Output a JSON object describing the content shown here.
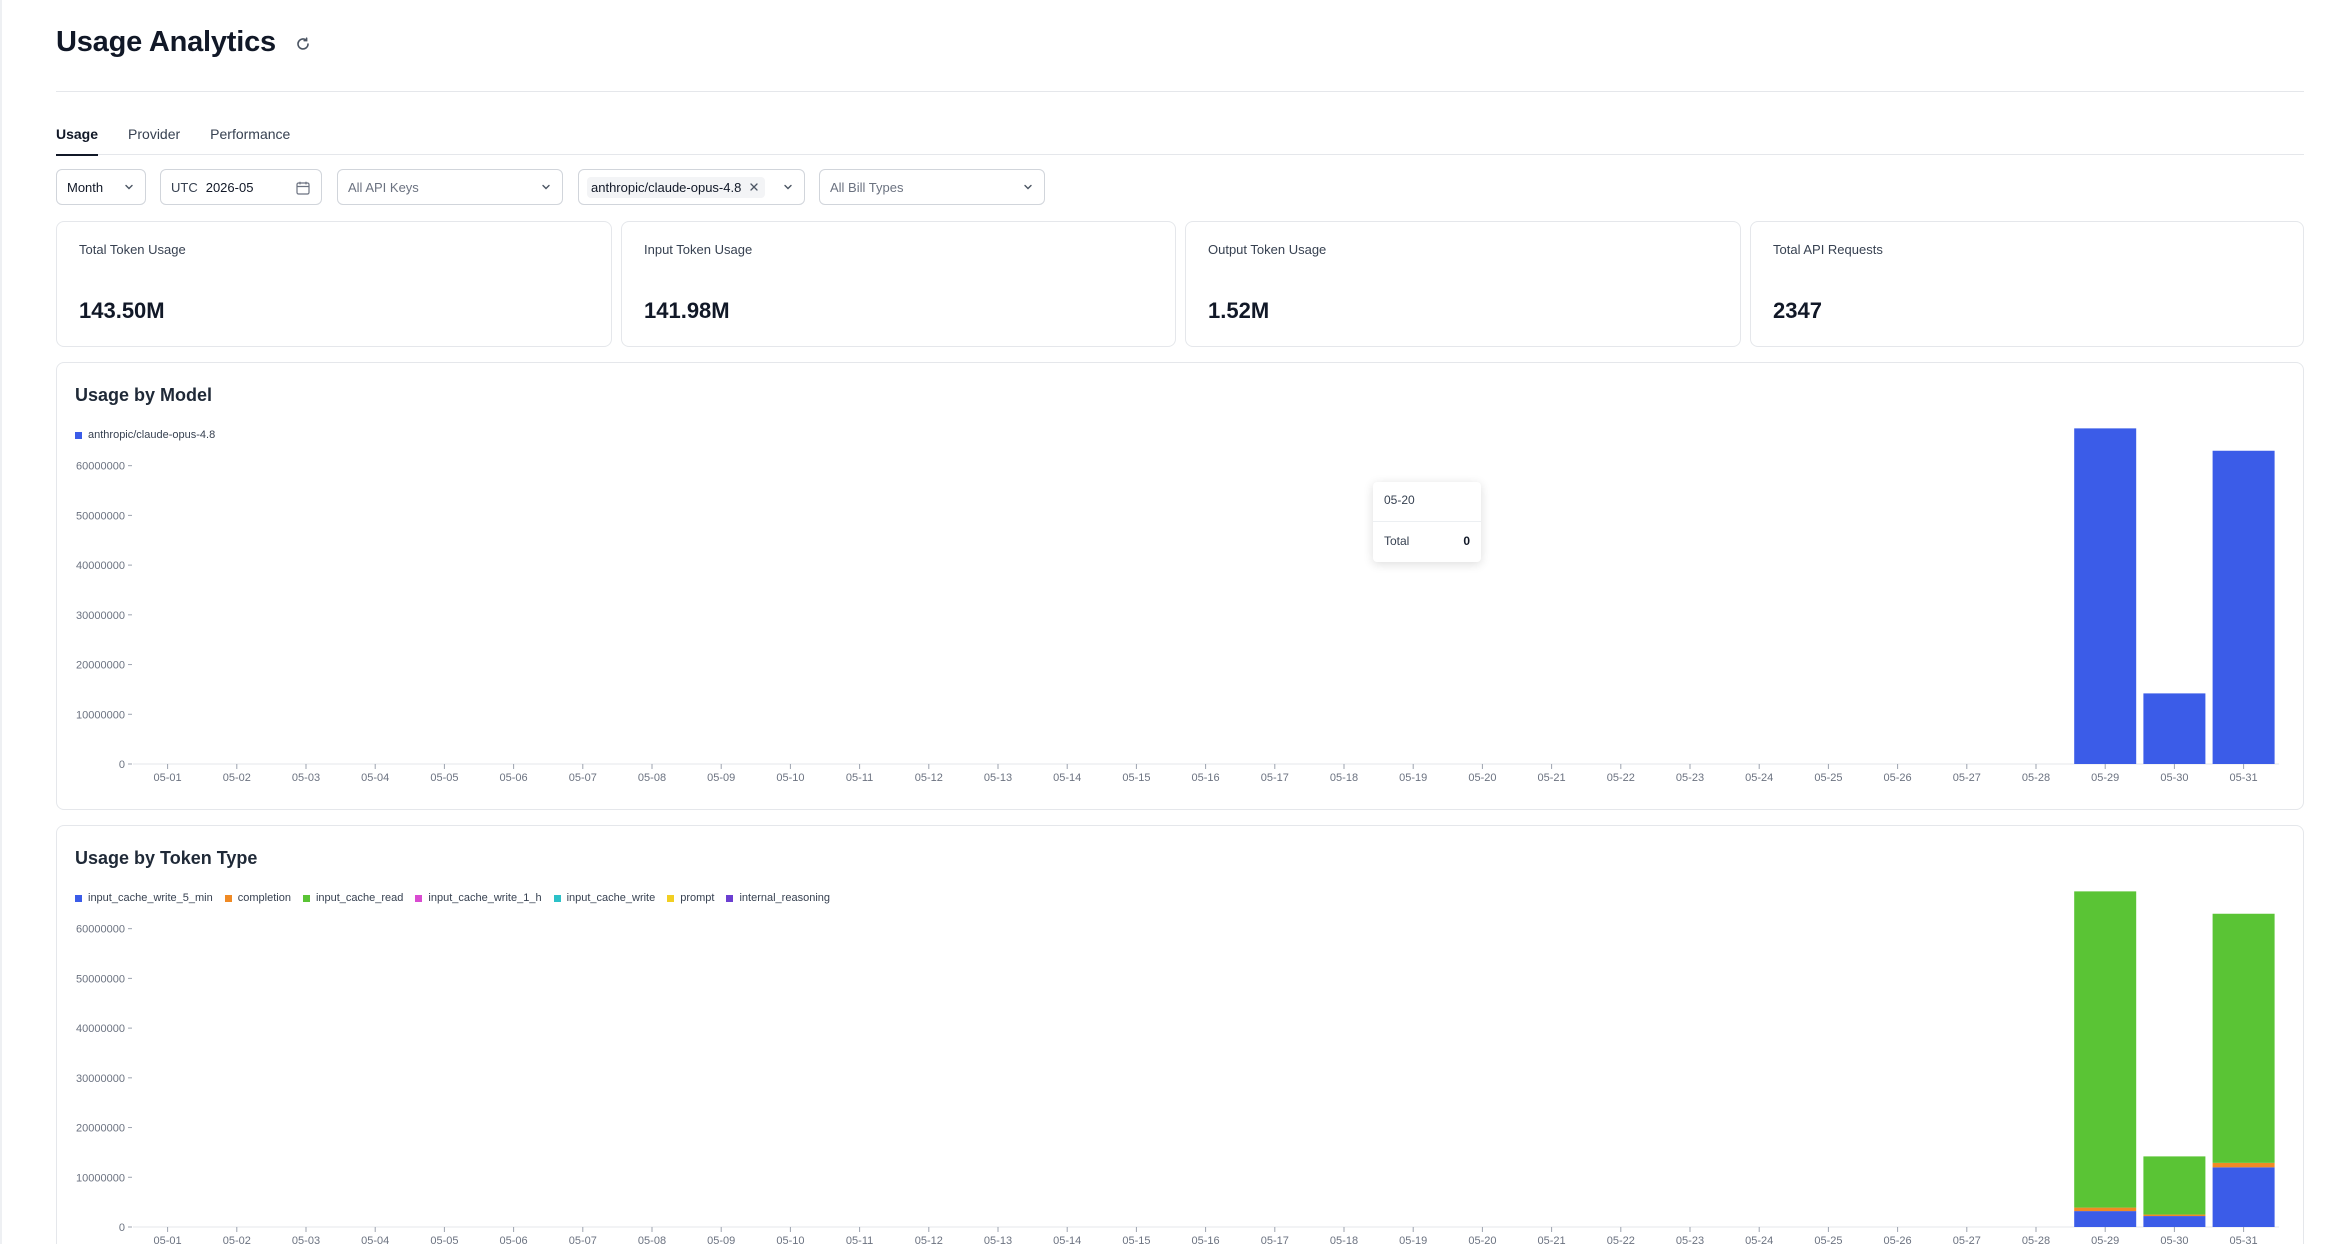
{
  "header": {
    "title": "Usage Analytics",
    "refresh_icon": "refresh-icon"
  },
  "tabs": [
    {
      "label": "Usage",
      "active": true
    },
    {
      "label": "Provider",
      "active": false
    },
    {
      "label": "Performance",
      "active": false
    }
  ],
  "filters": {
    "period": "Month",
    "timezone": "UTC",
    "date": "2026-05",
    "api_keys_placeholder": "All API Keys",
    "model_tag": "anthropic/claude-opus-4.8",
    "bill_types_placeholder": "All Bill Types"
  },
  "stats": [
    {
      "label": "Total Token Usage",
      "value": "143.50M"
    },
    {
      "label": "Input Token Usage",
      "value": "141.98M"
    },
    {
      "label": "Output Token Usage",
      "value": "1.52M"
    },
    {
      "label": "Total API Requests",
      "value": "2347"
    }
  ],
  "colors": {
    "primary_blue": "#3b5ce8",
    "green": "#5ac435",
    "orange": "#f08a24",
    "magenta": "#d94bd1",
    "teal": "#2cc1c8",
    "yellow": "#f2cf22",
    "purple": "#6b3fd1"
  },
  "tooltip": {
    "date": "05-20",
    "label": "Total",
    "value": "0"
  },
  "chart_data": [
    {
      "type": "bar",
      "title": "Usage by Model",
      "categories": [
        "05-01",
        "05-02",
        "05-03",
        "05-04",
        "05-05",
        "05-06",
        "05-07",
        "05-08",
        "05-09",
        "05-10",
        "05-11",
        "05-12",
        "05-13",
        "05-14",
        "05-15",
        "05-16",
        "05-17",
        "05-18",
        "05-19",
        "05-20",
        "05-21",
        "05-22",
        "05-23",
        "05-24",
        "05-25",
        "05-26",
        "05-27",
        "05-28",
        "05-29",
        "05-30",
        "05-31"
      ],
      "series": [
        {
          "name": "anthropic/claude-opus-4.8",
          "color": "#3b5ce8",
          "values": [
            0,
            0,
            0,
            0,
            0,
            0,
            0,
            0,
            0,
            0,
            0,
            0,
            0,
            0,
            0,
            0,
            0,
            0,
            0,
            0,
            0,
            0,
            0,
            0,
            0,
            0,
            0,
            0,
            67500000,
            14200000,
            63000000
          ]
        }
      ],
      "yticks": [
        0,
        10000000,
        20000000,
        30000000,
        40000000,
        50000000,
        60000000
      ],
      "ylim": [
        0,
        72000000
      ],
      "legend": "top-left",
      "grid": false
    },
    {
      "type": "bar",
      "stacked": true,
      "title": "Usage by Token Type",
      "categories": [
        "05-01",
        "05-02",
        "05-03",
        "05-04",
        "05-05",
        "05-06",
        "05-07",
        "05-08",
        "05-09",
        "05-10",
        "05-11",
        "05-12",
        "05-13",
        "05-14",
        "05-15",
        "05-16",
        "05-17",
        "05-18",
        "05-19",
        "05-20",
        "05-21",
        "05-22",
        "05-23",
        "05-24",
        "05-25",
        "05-26",
        "05-27",
        "05-28",
        "05-29",
        "05-30",
        "05-31"
      ],
      "series": [
        {
          "name": "input_cache_write_5_min",
          "color": "#3b5ce8",
          "values": [
            0,
            0,
            0,
            0,
            0,
            0,
            0,
            0,
            0,
            0,
            0,
            0,
            0,
            0,
            0,
            0,
            0,
            0,
            0,
            0,
            0,
            0,
            0,
            0,
            0,
            0,
            0,
            0,
            3200000,
            2200000,
            12000000
          ]
        },
        {
          "name": "completion",
          "color": "#f08a24",
          "values": [
            0,
            0,
            0,
            0,
            0,
            0,
            0,
            0,
            0,
            0,
            0,
            0,
            0,
            0,
            0,
            0,
            0,
            0,
            0,
            0,
            0,
            0,
            0,
            0,
            0,
            0,
            0,
            0,
            700000,
            300000,
            900000
          ]
        },
        {
          "name": "input_cache_read",
          "color": "#5ac435",
          "values": [
            0,
            0,
            0,
            0,
            0,
            0,
            0,
            0,
            0,
            0,
            0,
            0,
            0,
            0,
            0,
            0,
            0,
            0,
            0,
            0,
            0,
            0,
            0,
            0,
            0,
            0,
            0,
            0,
            63600000,
            11700000,
            50100000
          ]
        },
        {
          "name": "input_cache_write_1_h",
          "color": "#d94bd1",
          "values": [
            0,
            0,
            0,
            0,
            0,
            0,
            0,
            0,
            0,
            0,
            0,
            0,
            0,
            0,
            0,
            0,
            0,
            0,
            0,
            0,
            0,
            0,
            0,
            0,
            0,
            0,
            0,
            0,
            0,
            0,
            0
          ]
        },
        {
          "name": "input_cache_write",
          "color": "#2cc1c8",
          "values": [
            0,
            0,
            0,
            0,
            0,
            0,
            0,
            0,
            0,
            0,
            0,
            0,
            0,
            0,
            0,
            0,
            0,
            0,
            0,
            0,
            0,
            0,
            0,
            0,
            0,
            0,
            0,
            0,
            0,
            0,
            0
          ]
        },
        {
          "name": "prompt",
          "color": "#f2cf22",
          "values": [
            0,
            0,
            0,
            0,
            0,
            0,
            0,
            0,
            0,
            0,
            0,
            0,
            0,
            0,
            0,
            0,
            0,
            0,
            0,
            0,
            0,
            0,
            0,
            0,
            0,
            0,
            0,
            0,
            0,
            0,
            0
          ]
        },
        {
          "name": "internal_reasoning",
          "color": "#6b3fd1",
          "values": [
            0,
            0,
            0,
            0,
            0,
            0,
            0,
            0,
            0,
            0,
            0,
            0,
            0,
            0,
            0,
            0,
            0,
            0,
            0,
            0,
            0,
            0,
            0,
            0,
            0,
            0,
            0,
            0,
            0,
            0,
            0
          ]
        }
      ],
      "yticks": [
        0,
        10000000,
        20000000,
        30000000,
        40000000,
        50000000,
        60000000
      ],
      "ylim": [
        0,
        72000000
      ],
      "legend": "top-left",
      "grid": false
    }
  ]
}
